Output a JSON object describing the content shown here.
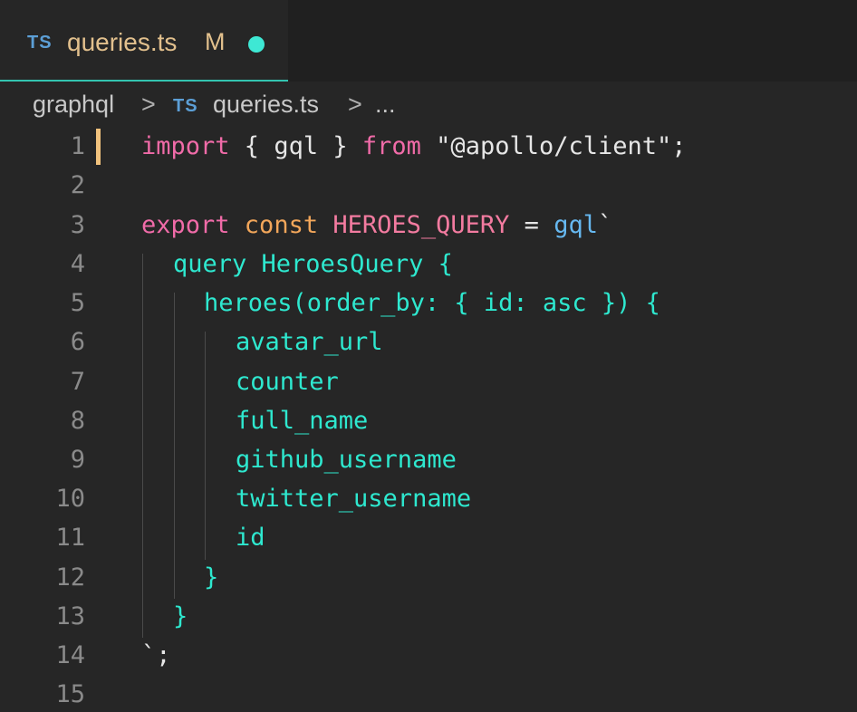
{
  "tab": {
    "icon": "TS",
    "filename": "queries.ts",
    "status": "M"
  },
  "breadcrumb": {
    "folder": "graphql",
    "separator": ">",
    "file_icon": "TS",
    "file": "queries.ts",
    "more": "..."
  },
  "colors": {
    "accent": "#33c4b0",
    "modified": "#e2c08d",
    "keyword": "#f06ba8",
    "graphql": "#2ee8cf",
    "ts_icon": "#5c9fd6"
  },
  "editor": {
    "line_numbers": [
      "1",
      "2",
      "3",
      "4",
      "5",
      "6",
      "7",
      "8",
      "9",
      "10",
      "11",
      "12",
      "13",
      "14",
      "15"
    ],
    "lines": {
      "l1": {
        "import": "import",
        "open": " { ",
        "name": "gql",
        "close": " } ",
        "from": "from",
        "string": " \"@apollo/client\"",
        "semi": ";"
      },
      "l3": {
        "export": "export",
        "const": " const",
        "ident": " HEROES_QUERY",
        "eq": " = ",
        "tag": "gql",
        "tick": "`"
      },
      "l4": "query HeroesQuery {",
      "l5": "heroes(order_by: { id: asc }) {",
      "l6": "avatar_url",
      "l7": "counter",
      "l8": "full_name",
      "l9": "github_username",
      "l10": "twitter_username",
      "l11": "id",
      "l12": "}",
      "l13": "}",
      "l14": {
        "tick": "`",
        "semi": ";"
      }
    }
  }
}
